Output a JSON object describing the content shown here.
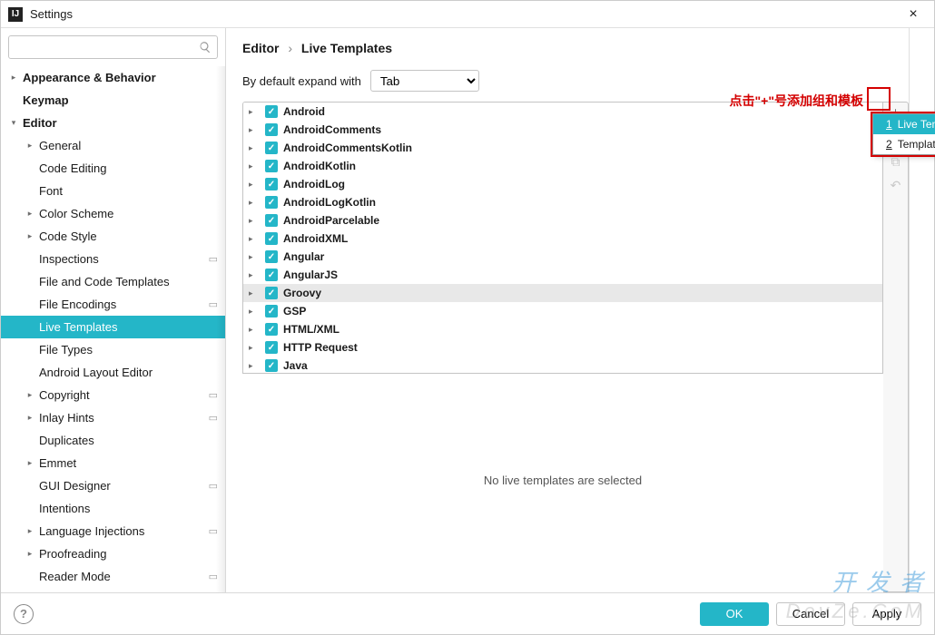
{
  "window": {
    "title": "Settings"
  },
  "search": {
    "placeholder": ""
  },
  "sidebar": {
    "items": [
      {
        "label": "Appearance & Behavior",
        "indent": 0,
        "bold": true,
        "arrow": "right",
        "gear": false
      },
      {
        "label": "Keymap",
        "indent": 0,
        "bold": true,
        "arrow": "",
        "gear": false
      },
      {
        "label": "Editor",
        "indent": 0,
        "bold": true,
        "arrow": "down",
        "gear": false
      },
      {
        "label": "General",
        "indent": 1,
        "bold": false,
        "arrow": "right",
        "gear": false
      },
      {
        "label": "Code Editing",
        "indent": 1,
        "bold": false,
        "arrow": "",
        "gear": false
      },
      {
        "label": "Font",
        "indent": 1,
        "bold": false,
        "arrow": "",
        "gear": false
      },
      {
        "label": "Color Scheme",
        "indent": 1,
        "bold": false,
        "arrow": "right",
        "gear": false
      },
      {
        "label": "Code Style",
        "indent": 1,
        "bold": false,
        "arrow": "right",
        "gear": false
      },
      {
        "label": "Inspections",
        "indent": 1,
        "bold": false,
        "arrow": "",
        "gear": true
      },
      {
        "label": "File and Code Templates",
        "indent": 1,
        "bold": false,
        "arrow": "",
        "gear": false
      },
      {
        "label": "File Encodings",
        "indent": 1,
        "bold": false,
        "arrow": "",
        "gear": true
      },
      {
        "label": "Live Templates",
        "indent": 1,
        "bold": false,
        "arrow": "",
        "gear": false,
        "selected": true
      },
      {
        "label": "File Types",
        "indent": 1,
        "bold": false,
        "arrow": "",
        "gear": false
      },
      {
        "label": "Android Layout Editor",
        "indent": 1,
        "bold": false,
        "arrow": "",
        "gear": false
      },
      {
        "label": "Copyright",
        "indent": 1,
        "bold": false,
        "arrow": "right",
        "gear": true
      },
      {
        "label": "Inlay Hints",
        "indent": 1,
        "bold": false,
        "arrow": "right",
        "gear": true
      },
      {
        "label": "Duplicates",
        "indent": 1,
        "bold": false,
        "arrow": "",
        "gear": false
      },
      {
        "label": "Emmet",
        "indent": 1,
        "bold": false,
        "arrow": "right",
        "gear": false
      },
      {
        "label": "GUI Designer",
        "indent": 1,
        "bold": false,
        "arrow": "",
        "gear": true
      },
      {
        "label": "Intentions",
        "indent": 1,
        "bold": false,
        "arrow": "",
        "gear": false
      },
      {
        "label": "Language Injections",
        "indent": 1,
        "bold": false,
        "arrow": "right",
        "gear": true
      },
      {
        "label": "Proofreading",
        "indent": 1,
        "bold": false,
        "arrow": "right",
        "gear": false
      },
      {
        "label": "Reader Mode",
        "indent": 1,
        "bold": false,
        "arrow": "",
        "gear": true
      }
    ]
  },
  "breadcrumb": {
    "part1": "Editor",
    "part2": "Live Templates"
  },
  "expand": {
    "label": "By default expand with",
    "value": "Tab"
  },
  "templates": [
    {
      "name": "Android"
    },
    {
      "name": "AndroidComments"
    },
    {
      "name": "AndroidCommentsKotlin"
    },
    {
      "name": "AndroidKotlin"
    },
    {
      "name": "AndroidLog"
    },
    {
      "name": "AndroidLogKotlin"
    },
    {
      "name": "AndroidParcelable"
    },
    {
      "name": "AndroidXML"
    },
    {
      "name": "Angular"
    },
    {
      "name": "AngularJS"
    },
    {
      "name": "Groovy",
      "highlighted": true
    },
    {
      "name": "GSP"
    },
    {
      "name": "HTML/XML"
    },
    {
      "name": "HTTP Request"
    },
    {
      "name": "Java"
    }
  ],
  "empty_message": "No live templates are selected",
  "annotation": "点击\"+\"号添加组和模板",
  "popup": {
    "items": [
      {
        "num": "1",
        "label": "Live Template",
        "selected": true
      },
      {
        "num": "2",
        "label": "Template Group..."
      }
    ]
  },
  "footer": {
    "ok": "OK",
    "cancel": "Cancel",
    "apply": "Apply"
  },
  "watermark1": "开 发 者",
  "watermark2": "DevZe.CoM"
}
